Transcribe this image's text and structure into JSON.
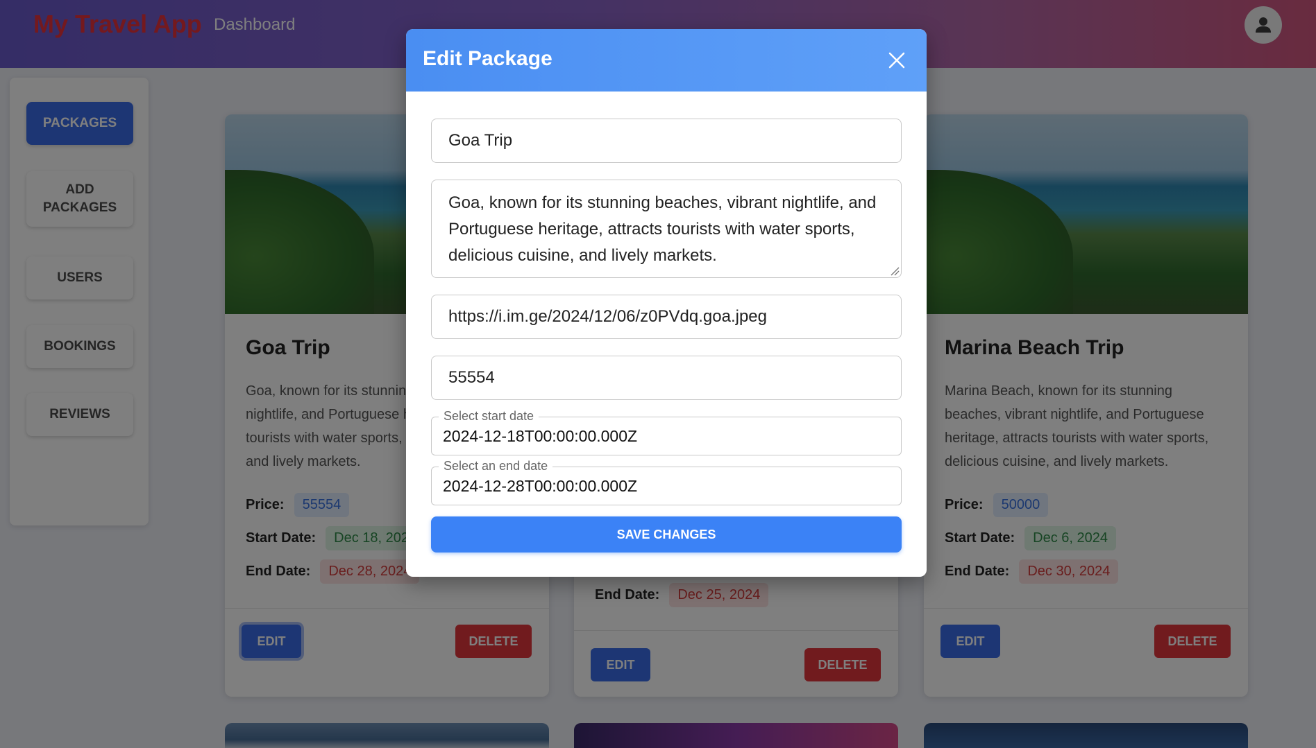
{
  "header": {
    "brand": "My Travel App",
    "nav_dashboard": "Dashboard",
    "avatar_icon": "user-icon"
  },
  "sidebar": {
    "items": [
      {
        "label": "PACKAGES",
        "active": true
      },
      {
        "label": "ADD PACKAGES",
        "active": false
      },
      {
        "label": "USERS",
        "active": false
      },
      {
        "label": "BOOKINGS",
        "active": false
      },
      {
        "label": "REVIEWS",
        "active": false
      }
    ]
  },
  "cards": [
    {
      "title": "Goa Trip",
      "description": "Goa, known for its stunning beaches, vibrant nightlife, and Portuguese heritage, attracts tourists with water sports, delicious cuisine, and lively markets.",
      "price_label": "Price:",
      "price": "55554",
      "start_label": "Start Date:",
      "start_date": "Dec 18, 2024",
      "end_label": "End Date:",
      "end_date": "Dec 28, 2024",
      "edit_label": "EDIT",
      "delete_label": "DELETE"
    },
    {
      "title": "",
      "description": "",
      "end_label": "End Date:",
      "end_date": "Dec 25, 2024",
      "edit_label": "EDIT",
      "delete_label": "DELETE"
    },
    {
      "title": "Marina Beach Trip",
      "description": "Marina Beach, known for its stunning beaches, vibrant nightlife, and Portuguese heritage, attracts tourists with water sports, delicious cuisine, and lively markets.",
      "price_label": "Price:",
      "price": "50000",
      "start_label": "Start Date:",
      "start_date": "Dec 6, 2024",
      "end_label": "End Date:",
      "end_date": "Dec 30, 2024",
      "edit_label": "EDIT",
      "delete_label": "DELETE"
    }
  ],
  "modal": {
    "title": "Edit Package",
    "close_icon": "close-icon",
    "name_value": "Goa Trip",
    "description_value": "Goa, known for its stunning beaches, vibrant nightlife, and Portuguese heritage, attracts tourists with water sports, delicious cuisine, and lively markets.",
    "image_url_value": "https://i.im.ge/2024/12/06/z0PVdq.goa.jpeg",
    "price_value": "55554",
    "start_date_label": "Select start date",
    "start_date_value": "2024-12-18T00:00:00.000Z",
    "end_date_label": "Select an end date",
    "end_date_value": "2024-12-28T00:00:00.000Z",
    "save_label": "SAVE CHANGES"
  },
  "colors": {
    "brand_text": "#e8323c",
    "primary": "#3b6ce8",
    "danger": "#e3363d",
    "modal_header": "#4a8ef2",
    "save_button": "#3b82f6"
  }
}
